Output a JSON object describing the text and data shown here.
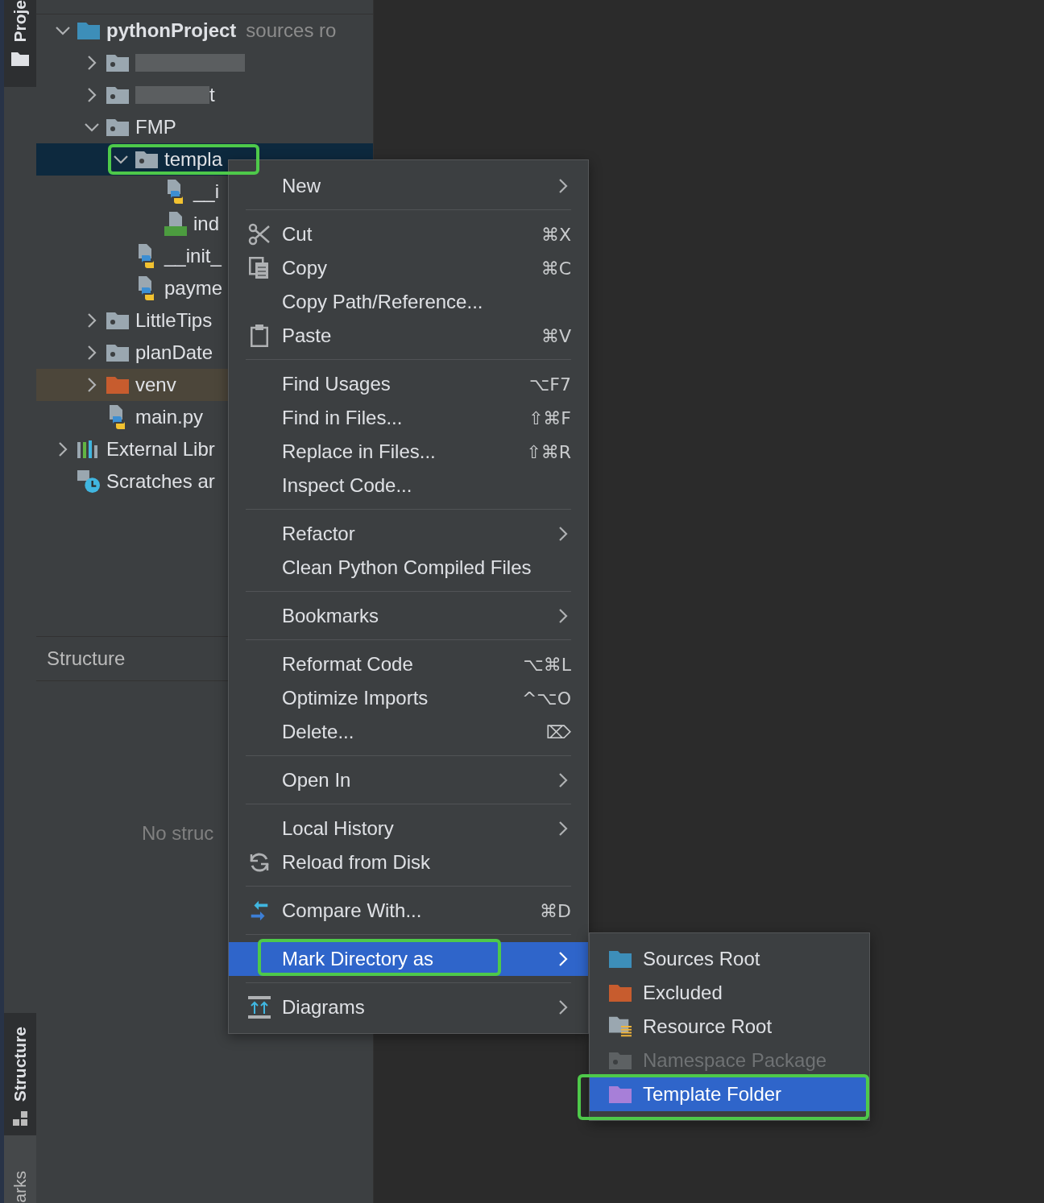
{
  "tool_stripe": [
    {
      "label": "Proje",
      "selected": true
    },
    {
      "label": "Structure",
      "selected": true
    },
    {
      "label": "arks",
      "selected": false
    }
  ],
  "project_tree": [
    {
      "label": "pythonProject",
      "hint": "sources ro",
      "kind": "root",
      "expanded": true,
      "selected": false,
      "annotated": false,
      "children": [
        {
          "redacted": true,
          "kind": "folder",
          "expanded": false,
          "selected": false,
          "annotated": false
        },
        {
          "redacted": true,
          "label": "t",
          "kind": "folder",
          "expanded": false,
          "selected": false,
          "annotated": false
        },
        {
          "label": "FMP",
          "kind": "folder",
          "expanded": true,
          "selected": false,
          "annotated": false,
          "children": [
            {
              "label": "templa",
              "kind": "folder",
              "expanded": true,
              "selected": true,
              "annotated": true,
              "children": [
                {
                  "label": "__i",
                  "kind": "python",
                  "selected": false,
                  "annotated": false
                },
                {
                  "label": "ind",
                  "kind": "html",
                  "selected": false,
                  "annotated": false
                }
              ]
            },
            {
              "label": "__init_",
              "kind": "python",
              "selected": false,
              "annotated": false
            },
            {
              "label": "payme",
              "kind": "python",
              "selected": false,
              "annotated": false
            }
          ]
        },
        {
          "label": "LittleTips",
          "kind": "folder",
          "expanded": false,
          "selected": false,
          "annotated": false
        },
        {
          "label": "planDate",
          "kind": "folder",
          "expanded": false,
          "selected": false,
          "annotated": false
        },
        {
          "label": "venv",
          "kind": "excluded",
          "expanded": false,
          "selected": false,
          "annotated": false
        },
        {
          "label": "main.py",
          "kind": "python",
          "selected": false,
          "annotated": false
        }
      ]
    },
    {
      "label": "External Libr",
      "kind": "libraries",
      "expanded": false,
      "selected": false,
      "annotated": false
    },
    {
      "label": "Scratches ar",
      "kind": "scratches",
      "selected": false,
      "annotated": false
    }
  ],
  "structure_panel": {
    "title": "Structure",
    "empty_text": "No struc"
  },
  "context_menu": {
    "items": [
      {
        "kind": "plain",
        "label": "New",
        "submenu": true,
        "selected": false,
        "annotated": false
      },
      {
        "kind": "separator"
      },
      {
        "kind": "cut",
        "label": "Cut",
        "shortcut": "⌘X",
        "selected": false,
        "annotated": false
      },
      {
        "kind": "copy",
        "label": "Copy",
        "shortcut": "⌘C",
        "selected": false,
        "annotated": false
      },
      {
        "kind": "plain",
        "label": "Copy Path/Reference...",
        "selected": false,
        "annotated": false
      },
      {
        "kind": "paste",
        "label": "Paste",
        "shortcut": "⌘V",
        "selected": false,
        "annotated": false
      },
      {
        "kind": "separator"
      },
      {
        "kind": "plain",
        "label": "Find Usages",
        "shortcut": "⌥F7",
        "selected": false,
        "annotated": false
      },
      {
        "kind": "plain",
        "label": "Find in Files...",
        "shortcut": "⇧⌘F",
        "selected": false,
        "annotated": false
      },
      {
        "kind": "plain",
        "label": "Replace in Files...",
        "shortcut": "⇧⌘R",
        "selected": false,
        "annotated": false
      },
      {
        "kind": "plain",
        "label": "Inspect Code...",
        "selected": false,
        "annotated": false
      },
      {
        "kind": "separator"
      },
      {
        "kind": "plain",
        "label": "Refactor",
        "submenu": true,
        "selected": false,
        "annotated": false
      },
      {
        "kind": "plain",
        "label": "Clean Python Compiled Files",
        "selected": false,
        "annotated": false
      },
      {
        "kind": "separator"
      },
      {
        "kind": "plain",
        "label": "Bookmarks",
        "submenu": true,
        "selected": false,
        "annotated": false
      },
      {
        "kind": "separator"
      },
      {
        "kind": "plain",
        "label": "Reformat Code",
        "shortcut": "⌥⌘L",
        "selected": false,
        "annotated": false
      },
      {
        "kind": "plain",
        "label": "Optimize Imports",
        "shortcut": "^⌥O",
        "selected": false,
        "annotated": false
      },
      {
        "kind": "plain",
        "label": "Delete...",
        "shortcut": "⌦",
        "selected": false,
        "annotated": false
      },
      {
        "kind": "separator"
      },
      {
        "kind": "plain",
        "label": "Open In",
        "submenu": true,
        "selected": false,
        "annotated": false
      },
      {
        "kind": "separator"
      },
      {
        "kind": "plain",
        "label": "Local History",
        "submenu": true,
        "selected": false,
        "annotated": false
      },
      {
        "kind": "reload",
        "label": "Reload from Disk",
        "selected": false,
        "annotated": false
      },
      {
        "kind": "separator"
      },
      {
        "kind": "compare",
        "label": "Compare With...",
        "shortcut": "⌘D",
        "selected": false,
        "annotated": false
      },
      {
        "kind": "separator"
      },
      {
        "kind": "plain",
        "label": "Mark Directory as",
        "submenu": true,
        "selected": true,
        "annotated": true
      },
      {
        "kind": "separator"
      },
      {
        "kind": "diagrams",
        "label": "Diagrams",
        "submenu": true,
        "selected": false,
        "annotated": false
      }
    ]
  },
  "submenu": {
    "items": [
      {
        "kind": "source",
        "label": "Sources Root",
        "disabled": false,
        "selected": false,
        "annotated": false
      },
      {
        "kind": "excluded",
        "label": "Excluded",
        "disabled": false,
        "selected": false,
        "annotated": false
      },
      {
        "kind": "resource",
        "label": "Resource Root",
        "disabled": false,
        "selected": false,
        "annotated": false
      },
      {
        "kind": "namespace",
        "label": "Namespace Package",
        "disabled": true,
        "selected": false,
        "annotated": false
      },
      {
        "kind": "template",
        "label": "Template Folder",
        "disabled": false,
        "selected": true,
        "annotated": true
      }
    ]
  }
}
